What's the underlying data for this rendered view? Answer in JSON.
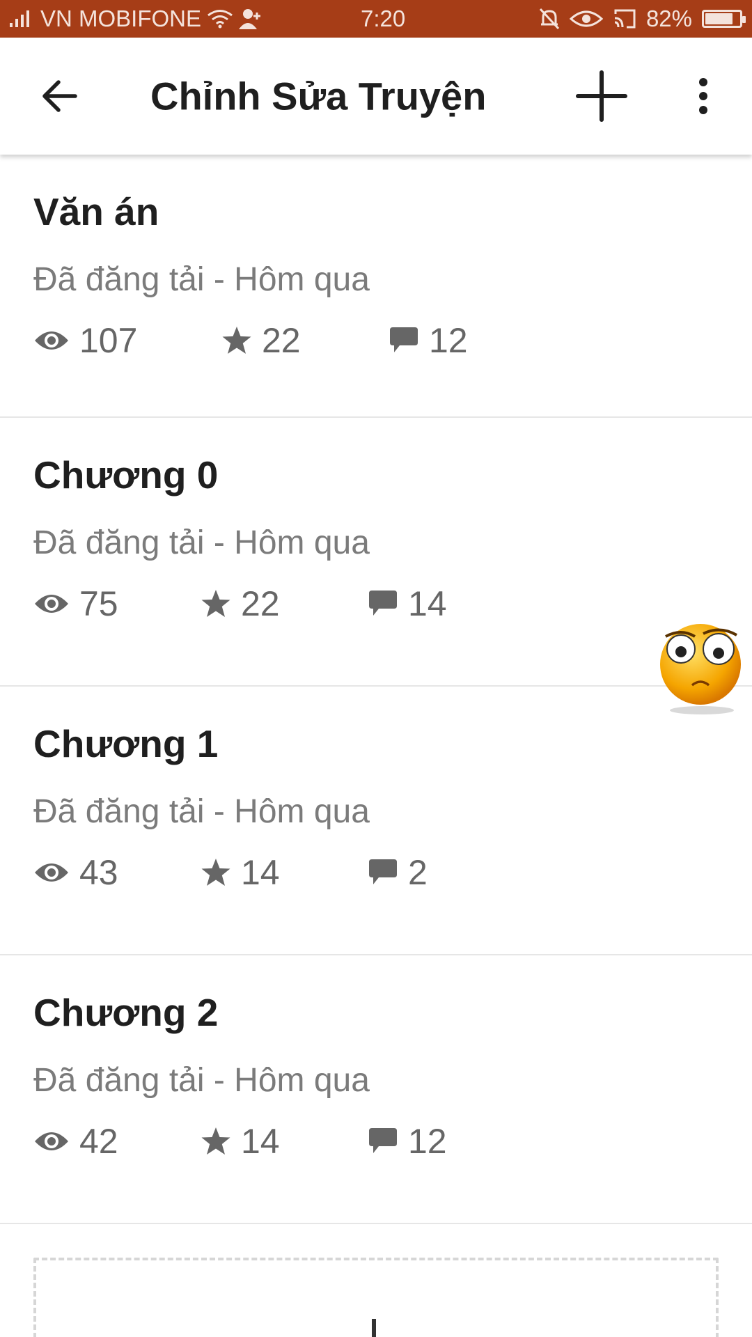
{
  "status_bar": {
    "carrier": "VN MOBIFONE",
    "time": "7:20",
    "battery": "82%",
    "battery_level": 0.82,
    "icons": [
      "signal-icon",
      "wifi-icon",
      "contact-icon",
      "mute-bell-icon",
      "eye-icon",
      "cast-icon",
      "battery-icon"
    ]
  },
  "app_bar": {
    "title": "Chỉnh Sửa Truyện",
    "back_icon": "arrow-left-icon",
    "add_icon": "plus-icon",
    "more_icon": "more-vert-icon"
  },
  "parts": [
    {
      "title": "Văn án",
      "status": "Đã đăng tải - Hôm qua",
      "views": "107",
      "votes": "22",
      "comments": "12"
    },
    {
      "title": "Chương 0",
      "status": "Đã đăng tải - Hôm qua",
      "views": "75",
      "votes": "22",
      "comments": "14"
    },
    {
      "title": "Chương 1",
      "status": "Đã đăng tải - Hôm qua",
      "views": "43",
      "votes": "14",
      "comments": "2"
    },
    {
      "title": "Chương 2",
      "status": "Đã đăng tải - Hôm qua",
      "views": "42",
      "votes": "14",
      "comments": "12"
    }
  ],
  "colors": {
    "status_bar": "#a63d17",
    "text_primary": "#1f1f1f",
    "text_secondary": "#7b7b7b",
    "icon": "#666666"
  }
}
